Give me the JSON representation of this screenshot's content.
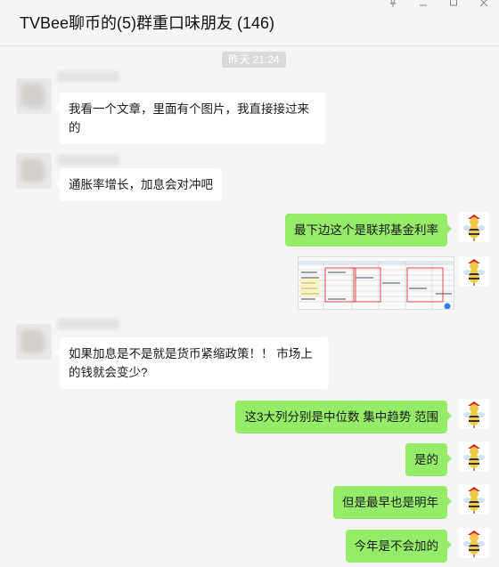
{
  "window": {
    "title": "TVBee聊币的(5)群重口味朋友 (146)",
    "controls": [
      "pin-icon",
      "minimize-icon",
      "maximize-icon",
      "close-icon"
    ]
  },
  "chat": {
    "timestamp": "昨天 21:24",
    "messages": [
      {
        "side": "left",
        "text": "我看一个文章，里面有个图片，我直接接过来\n的"
      },
      {
        "side": "left",
        "text": "通胀率增长，加息会对冲吧"
      },
      {
        "side": "right",
        "text": "最下边这个是联邦基金利率"
      },
      {
        "side": "right",
        "type": "image",
        "text": ""
      },
      {
        "side": "left",
        "text": "如果加息是不是就是货币紧缩政策！！ 市场上\n的钱就会变少?"
      },
      {
        "side": "right",
        "text": "这3大列分别是中位数 集中趋势 范围"
      },
      {
        "side": "right",
        "text": "是的"
      },
      {
        "side": "right",
        "text": "但是最早也是明年"
      },
      {
        "side": "right",
        "text": "今年是不会加的"
      }
    ]
  },
  "colors": {
    "background": "#f5f5f5",
    "self_bubble": "#95ec69",
    "other_bubble": "#ffffff",
    "timestamp_bg": "#dadada"
  }
}
